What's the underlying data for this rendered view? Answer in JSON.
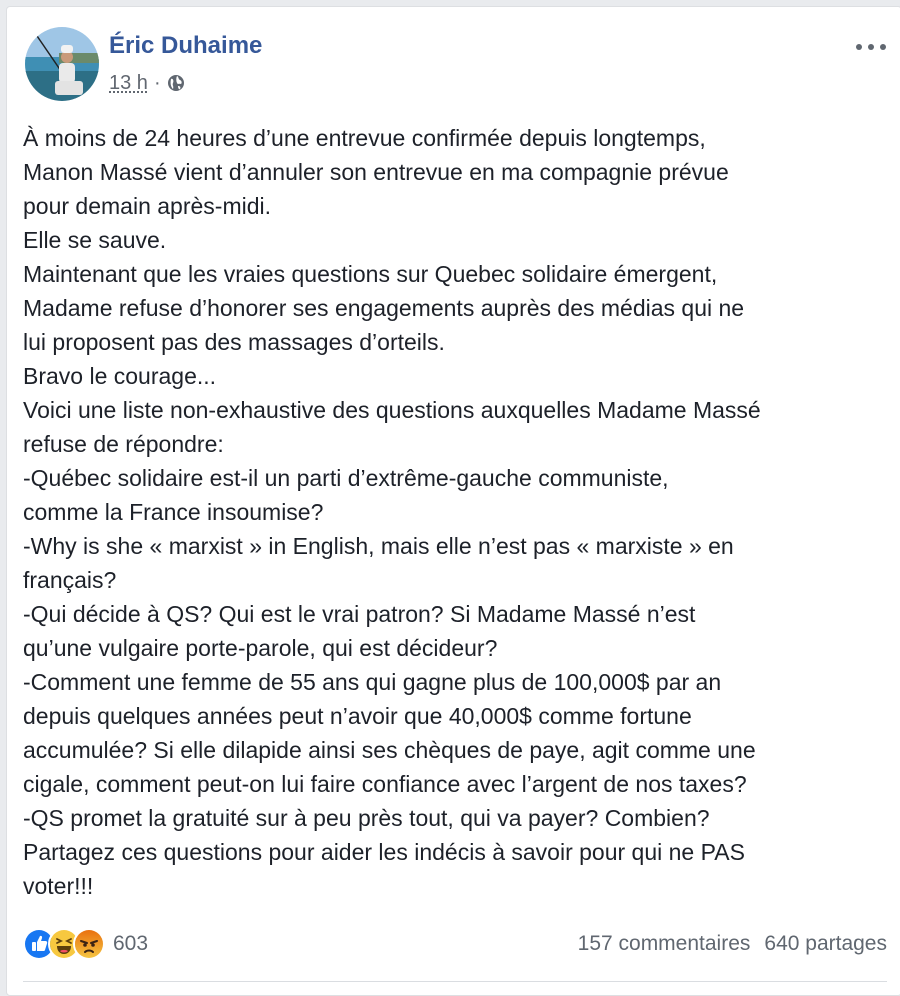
{
  "post": {
    "author": "Éric Duhaime",
    "time": "13 h",
    "separator": "·",
    "privacy_icon": "globe-icon",
    "menu_icon": "more-horizontal-icon",
    "lines": [
      "À moins de 24 heures d’une entrevue confirmée depuis longtemps,",
      "Manon Massé vient d’annuler son entrevue en ma compagnie prévue",
      "pour demain après-midi.",
      "Elle se sauve.",
      "Maintenant que les vraies questions sur Quebec solidaire émergent,",
      "Madame refuse d’honorer ses engagements auprès des médias qui ne",
      "lui proposent pas des massages d’orteils.",
      "Bravo le courage...",
      "Voici une liste non-exhaustive des questions auxquelles Madame Massé",
      "refuse de répondre:",
      "-Québec solidaire est-il un parti d’extrême-gauche communiste,",
      "comme la France insoumise?",
      "-Why is she « marxist » in English, mais elle n’est pas « marxiste » en",
      "français?",
      "-Qui décide à QS? Qui est le vrai patron? Si Madame Massé n’est",
      "qu’une vulgaire porte-parole, qui est décideur?",
      "-Comment une femme de 55 ans qui gagne plus de 100,000$ par an",
      "depuis quelques années peut n’avoir que 40,000$ comme fortune",
      "accumulée? Si elle dilapide ainsi ses chèques de paye, agit comme une",
      "cigale, comment peut-on lui faire confiance avec l’argent de nos taxes?",
      "-QS promet la gratuité sur à peu près tout, qui va payer? Combien?",
      "Partagez ces questions pour aider les indécis à savoir pour qui ne PAS",
      "voter!!!"
    ]
  },
  "footer": {
    "reaction_icons": [
      "like-icon",
      "haha-icon",
      "angry-icon"
    ],
    "reaction_count": "603",
    "comments": "157 commentaires",
    "shares": "640 partages"
  },
  "colors": {
    "author_link": "#365899",
    "body_text": "#1d2129",
    "meta_text": "#616770",
    "like_blue": "#1877f2",
    "reaction_yellow": "#f7c840",
    "angry_orange": "#e9710f"
  }
}
